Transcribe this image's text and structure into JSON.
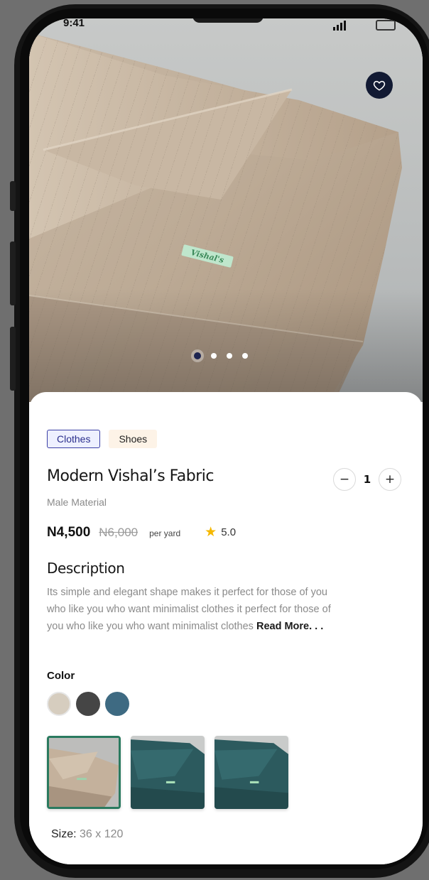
{
  "status_bar": {
    "time": "9:41"
  },
  "hero": {
    "brand_label": "Vishal's",
    "dots": [
      {
        "active": true
      },
      {
        "active": false
      },
      {
        "active": false
      },
      {
        "active": false
      }
    ]
  },
  "tags": [
    {
      "label": "Clothes",
      "active": true
    },
    {
      "label": "Shoes",
      "active": false
    }
  ],
  "product": {
    "title": "Modern Vishal’s Fabric",
    "subtitle": "Male Material",
    "price": "N4,500",
    "old_price": "N6,000",
    "unit": "per yard",
    "rating": "5.0",
    "quantity": "1"
  },
  "stepper": {
    "minus": "−",
    "plus": "+"
  },
  "description": {
    "title": "Description",
    "text": "Its simple and elegant shape makes it perfect for those of you who like you who want minimalist clothes it perfect for those of you who like you who want minimalist clothes",
    "read_more": "Read More. . ."
  },
  "color_section": {
    "title": "Color",
    "swatches": [
      "#d6cdbf",
      "#454545",
      "#3e6a82"
    ]
  },
  "size": {
    "label": "Size:",
    "value": "36 x 120"
  },
  "colors": {
    "accent": "#2a2e8c",
    "thumb_selected": "#2a7a5f",
    "fav_bg": "#121a33"
  }
}
